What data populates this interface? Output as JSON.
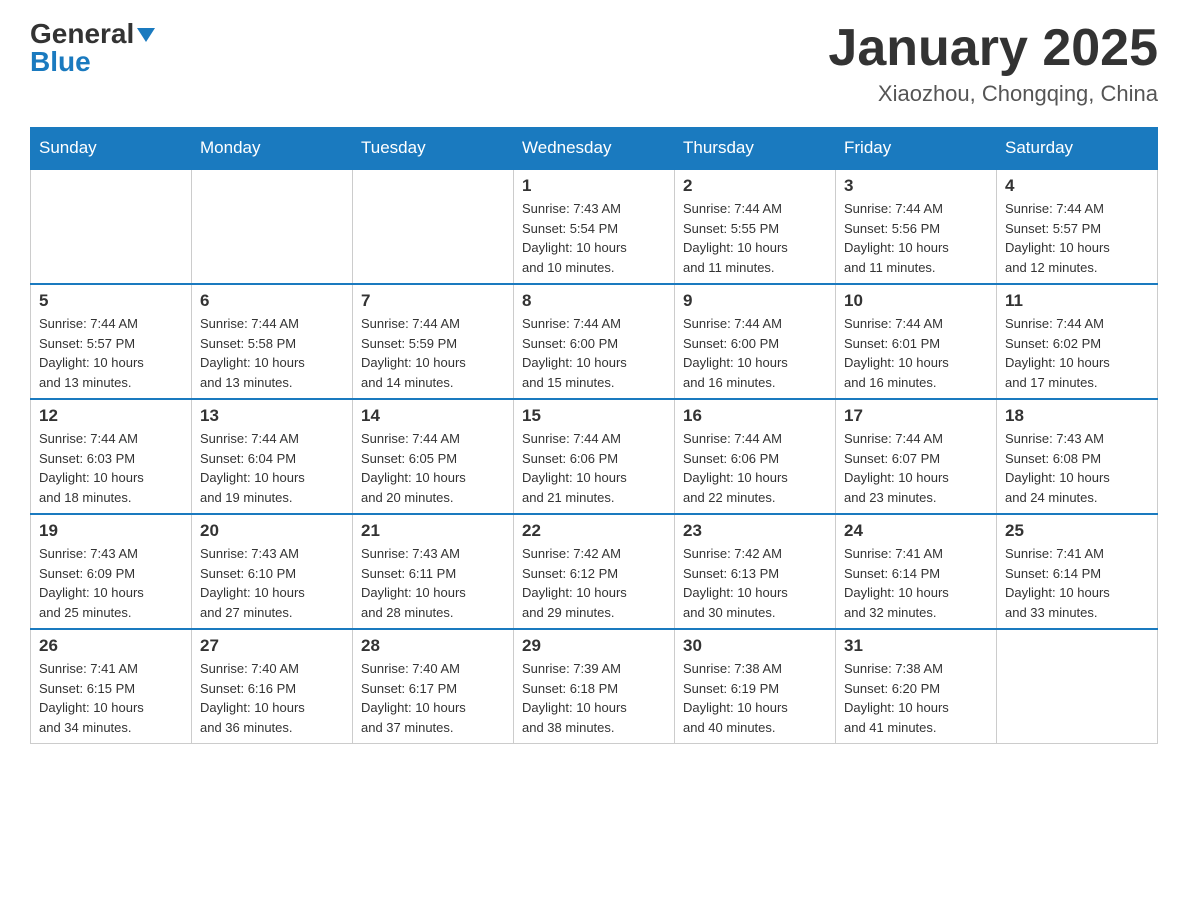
{
  "header": {
    "logo_general": "General",
    "logo_blue": "Blue",
    "month_title": "January 2025",
    "location": "Xiaozhou, Chongqing, China"
  },
  "weekdays": [
    "Sunday",
    "Monday",
    "Tuesday",
    "Wednesday",
    "Thursday",
    "Friday",
    "Saturday"
  ],
  "weeks": [
    [
      {
        "day": "",
        "info": ""
      },
      {
        "day": "",
        "info": ""
      },
      {
        "day": "",
        "info": ""
      },
      {
        "day": "1",
        "info": "Sunrise: 7:43 AM\nSunset: 5:54 PM\nDaylight: 10 hours\nand 10 minutes."
      },
      {
        "day": "2",
        "info": "Sunrise: 7:44 AM\nSunset: 5:55 PM\nDaylight: 10 hours\nand 11 minutes."
      },
      {
        "day": "3",
        "info": "Sunrise: 7:44 AM\nSunset: 5:56 PM\nDaylight: 10 hours\nand 11 minutes."
      },
      {
        "day": "4",
        "info": "Sunrise: 7:44 AM\nSunset: 5:57 PM\nDaylight: 10 hours\nand 12 minutes."
      }
    ],
    [
      {
        "day": "5",
        "info": "Sunrise: 7:44 AM\nSunset: 5:57 PM\nDaylight: 10 hours\nand 13 minutes."
      },
      {
        "day": "6",
        "info": "Sunrise: 7:44 AM\nSunset: 5:58 PM\nDaylight: 10 hours\nand 13 minutes."
      },
      {
        "day": "7",
        "info": "Sunrise: 7:44 AM\nSunset: 5:59 PM\nDaylight: 10 hours\nand 14 minutes."
      },
      {
        "day": "8",
        "info": "Sunrise: 7:44 AM\nSunset: 6:00 PM\nDaylight: 10 hours\nand 15 minutes."
      },
      {
        "day": "9",
        "info": "Sunrise: 7:44 AM\nSunset: 6:00 PM\nDaylight: 10 hours\nand 16 minutes."
      },
      {
        "day": "10",
        "info": "Sunrise: 7:44 AM\nSunset: 6:01 PM\nDaylight: 10 hours\nand 16 minutes."
      },
      {
        "day": "11",
        "info": "Sunrise: 7:44 AM\nSunset: 6:02 PM\nDaylight: 10 hours\nand 17 minutes."
      }
    ],
    [
      {
        "day": "12",
        "info": "Sunrise: 7:44 AM\nSunset: 6:03 PM\nDaylight: 10 hours\nand 18 minutes."
      },
      {
        "day": "13",
        "info": "Sunrise: 7:44 AM\nSunset: 6:04 PM\nDaylight: 10 hours\nand 19 minutes."
      },
      {
        "day": "14",
        "info": "Sunrise: 7:44 AM\nSunset: 6:05 PM\nDaylight: 10 hours\nand 20 minutes."
      },
      {
        "day": "15",
        "info": "Sunrise: 7:44 AM\nSunset: 6:06 PM\nDaylight: 10 hours\nand 21 minutes."
      },
      {
        "day": "16",
        "info": "Sunrise: 7:44 AM\nSunset: 6:06 PM\nDaylight: 10 hours\nand 22 minutes."
      },
      {
        "day": "17",
        "info": "Sunrise: 7:44 AM\nSunset: 6:07 PM\nDaylight: 10 hours\nand 23 minutes."
      },
      {
        "day": "18",
        "info": "Sunrise: 7:43 AM\nSunset: 6:08 PM\nDaylight: 10 hours\nand 24 minutes."
      }
    ],
    [
      {
        "day": "19",
        "info": "Sunrise: 7:43 AM\nSunset: 6:09 PM\nDaylight: 10 hours\nand 25 minutes."
      },
      {
        "day": "20",
        "info": "Sunrise: 7:43 AM\nSunset: 6:10 PM\nDaylight: 10 hours\nand 27 minutes."
      },
      {
        "day": "21",
        "info": "Sunrise: 7:43 AM\nSunset: 6:11 PM\nDaylight: 10 hours\nand 28 minutes."
      },
      {
        "day": "22",
        "info": "Sunrise: 7:42 AM\nSunset: 6:12 PM\nDaylight: 10 hours\nand 29 minutes."
      },
      {
        "day": "23",
        "info": "Sunrise: 7:42 AM\nSunset: 6:13 PM\nDaylight: 10 hours\nand 30 minutes."
      },
      {
        "day": "24",
        "info": "Sunrise: 7:41 AM\nSunset: 6:14 PM\nDaylight: 10 hours\nand 32 minutes."
      },
      {
        "day": "25",
        "info": "Sunrise: 7:41 AM\nSunset: 6:14 PM\nDaylight: 10 hours\nand 33 minutes."
      }
    ],
    [
      {
        "day": "26",
        "info": "Sunrise: 7:41 AM\nSunset: 6:15 PM\nDaylight: 10 hours\nand 34 minutes."
      },
      {
        "day": "27",
        "info": "Sunrise: 7:40 AM\nSunset: 6:16 PM\nDaylight: 10 hours\nand 36 minutes."
      },
      {
        "day": "28",
        "info": "Sunrise: 7:40 AM\nSunset: 6:17 PM\nDaylight: 10 hours\nand 37 minutes."
      },
      {
        "day": "29",
        "info": "Sunrise: 7:39 AM\nSunset: 6:18 PM\nDaylight: 10 hours\nand 38 minutes."
      },
      {
        "day": "30",
        "info": "Sunrise: 7:38 AM\nSunset: 6:19 PM\nDaylight: 10 hours\nand 40 minutes."
      },
      {
        "day": "31",
        "info": "Sunrise: 7:38 AM\nSunset: 6:20 PM\nDaylight: 10 hours\nand 41 minutes."
      },
      {
        "day": "",
        "info": ""
      }
    ]
  ]
}
